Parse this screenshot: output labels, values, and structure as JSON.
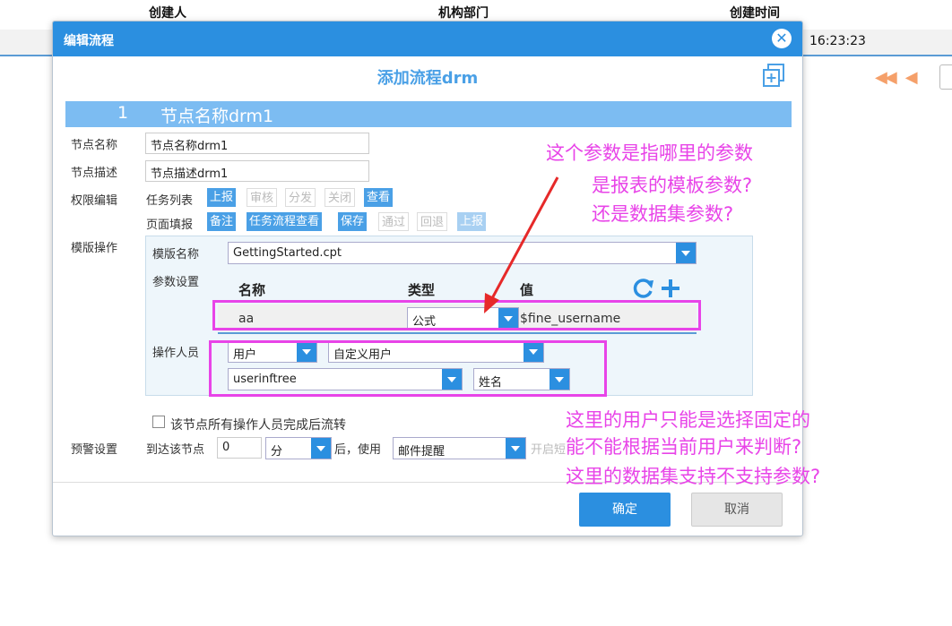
{
  "background": {
    "col_creator": "创建人",
    "col_dept": "机构部门",
    "col_time": "创建时间",
    "time_value": "16:23:23"
  },
  "dialog": {
    "title": "编辑流程",
    "close_icon": "close-circle-icon",
    "form_title": "添加流程drm",
    "node_number": "1",
    "node_name": "节点名称drm1",
    "fields": {
      "node_name_label": "节点名称",
      "node_name_value": "节点名称drm1",
      "node_desc_label": "节点描述",
      "node_desc_value": "节点描述drm1",
      "perm_label": "权限编辑",
      "task_list_label": "任务列表",
      "task_tags": [
        "上报",
        "审核",
        "分发",
        "关闭",
        "查看"
      ],
      "page_fill_label": "页面填报",
      "page_tags": [
        "备注",
        "任务流程查看",
        "保存",
        "通过",
        "回退",
        "上报"
      ],
      "template_op_label": "模版操作",
      "template_name_label": "模版名称",
      "template_name_value": "GettingStarted.cpt",
      "param_label": "参数设置",
      "param_head_name": "名称",
      "param_head_type": "类型",
      "param_head_value": "值",
      "param_name": "aa",
      "param_type": "公式",
      "param_value": "$fine_username",
      "operator_label": "操作人员",
      "op_type": "用户",
      "op_subtype": "自定义用户",
      "op_dataset": "userinftree",
      "op_field": "姓名",
      "flow_check_label": "该节点所有操作人员完成后流转",
      "warn_label": "预警设置",
      "warn_arrive": "到达该节点",
      "warn_num": "0",
      "warn_unit": "分",
      "warn_after": "后，使用",
      "warn_method": "邮件提醒",
      "warn_trailing": "开启短"
    },
    "btn_ok": "确定",
    "btn_cancel": "取消"
  },
  "notes": {
    "line1": "这个参数是指哪里的参数",
    "line2": "是报表的模板参数?",
    "line3": "还是数据集参数?",
    "line4": "这里的用户只能是选择固定的",
    "line5": "能不能根据当前用户来判断?",
    "line6": "这里的数据集支持不支持参数?"
  },
  "colors": {
    "accent": "#2b8fe0",
    "annotation": "#e844e8"
  }
}
